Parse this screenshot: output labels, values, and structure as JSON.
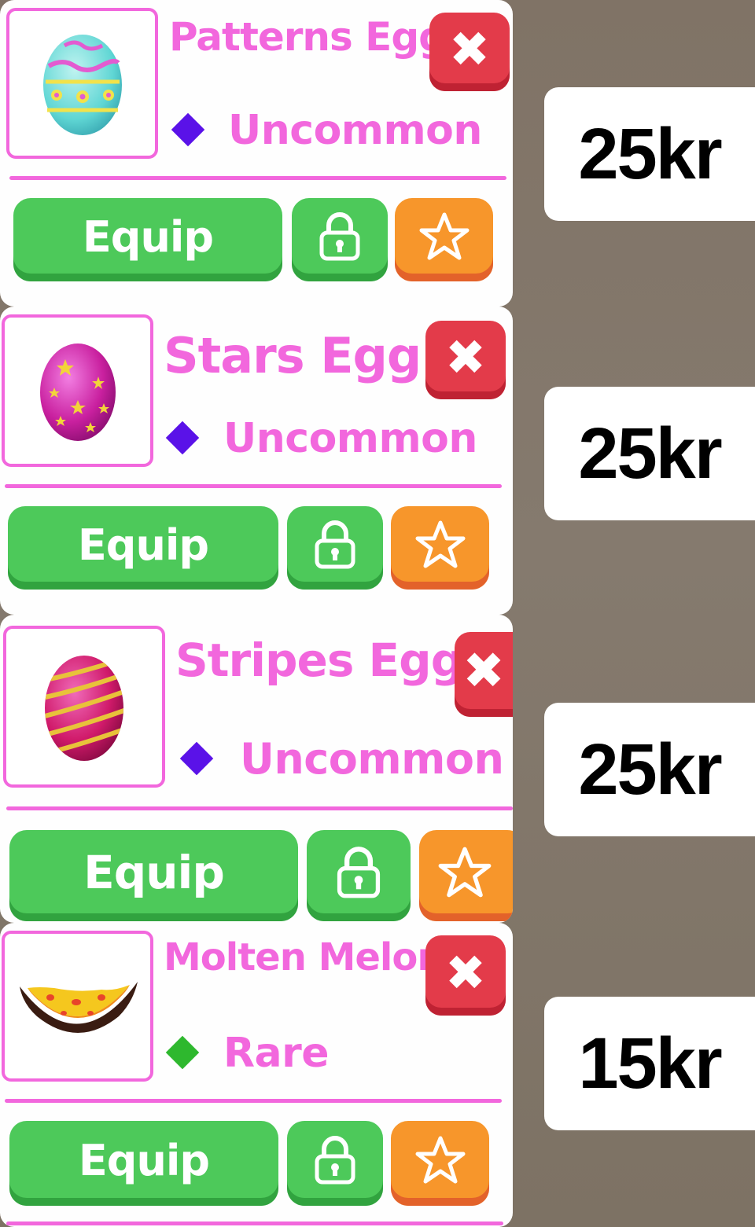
{
  "items": [
    {
      "name": "Patterns Egg",
      "rarity": "Uncommon",
      "rarity_color": "#5a12e8",
      "equip_label": "Equip",
      "close_symbol": "✖",
      "price": "25kr",
      "image_icon": "patterns-egg-icon"
    },
    {
      "name": "Stars Egg",
      "rarity": "Uncommon",
      "rarity_color": "#5a12e8",
      "equip_label": "Equip",
      "close_symbol": "✖",
      "price": "25kr",
      "image_icon": "stars-egg-icon"
    },
    {
      "name": "Stripes Egg",
      "rarity": "Uncommon",
      "rarity_color": "#5a12e8",
      "equip_label": "Equip",
      "close_symbol": "✖",
      "price": "25kr",
      "image_icon": "stripes-egg-icon"
    },
    {
      "name": "Molten Melon",
      "rarity": "Rare",
      "rarity_color": "#2eb82e",
      "equip_label": "Equip",
      "close_symbol": "✖",
      "price": "15kr",
      "image_icon": "molten-melon-icon"
    }
  ],
  "colors": {
    "accent_pink": "#f267dd",
    "equip_green": "#4dc95a",
    "star_orange": "#f7962b",
    "close_red": "#e33b4a",
    "background": "#807366"
  }
}
